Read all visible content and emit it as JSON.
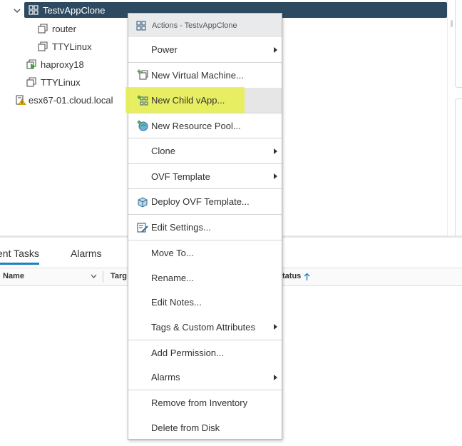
{
  "tree": {
    "selected": "TestvAppClone",
    "items": [
      {
        "label": "TestvAppClone",
        "icon": "vapp-icon"
      },
      {
        "label": "router",
        "icon": "vm-icon"
      },
      {
        "label": "TTYLinux",
        "icon": "vm-icon"
      },
      {
        "label": "haproxy18",
        "icon": "vm-powered-on-icon"
      },
      {
        "label": "TTYLinux",
        "icon": "vm-icon"
      },
      {
        "label": "esx67-01.cloud.local",
        "icon": "host-warning-icon"
      }
    ]
  },
  "bottom_panel": {
    "tabs": [
      "ent Tasks",
      "Alarms"
    ],
    "active_tab": "ent Tasks",
    "columns": [
      "Name",
      "Targ",
      "tatus"
    ]
  },
  "context_menu": {
    "title": "Actions - TestvAppClone",
    "items": [
      {
        "label": "Power",
        "submenu": true
      },
      {
        "label": "New Virtual Machine...",
        "icon": "new-vm-icon"
      },
      {
        "label": "New Child vApp...",
        "icon": "new-vapp-icon",
        "highlighted": true
      },
      {
        "label": "New Resource Pool...",
        "icon": "resource-pool-icon"
      },
      {
        "label": "Clone",
        "submenu": true
      },
      {
        "label": "OVF Template",
        "submenu": true
      },
      {
        "label": "Deploy OVF Template...",
        "icon": "deploy-ovf-icon"
      },
      {
        "label": "Edit Settings...",
        "icon": "edit-settings-icon"
      },
      {
        "label": "Move To..."
      },
      {
        "label": "Rename..."
      },
      {
        "label": "Edit Notes..."
      },
      {
        "label": "Tags & Custom Attributes",
        "submenu": true
      },
      {
        "label": "Add Permission..."
      },
      {
        "label": "Alarms",
        "submenu": true
      },
      {
        "label": "Remove from Inventory"
      },
      {
        "label": "Delete from Disk"
      }
    ]
  },
  "colors": {
    "selected_row": "#2d4a60",
    "highlight": "#e8ee4a",
    "tab_underline": "#1c80c4",
    "sort_arrow": "#1c80c4"
  }
}
